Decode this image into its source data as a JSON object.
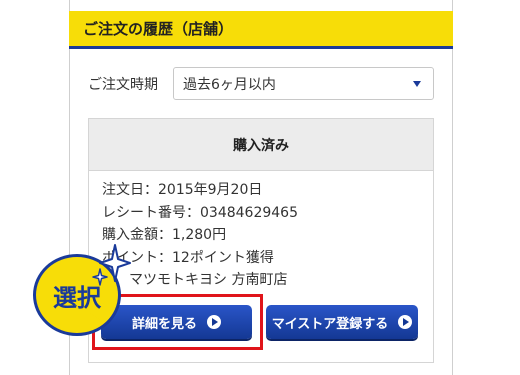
{
  "header": {
    "title": "ご注文の履歴（店舗）"
  },
  "filter": {
    "label": "ご注文時期",
    "selected": "過去6ヶ月以内"
  },
  "order": {
    "status": "購入済み",
    "date": "注文日：2015年9月20日",
    "receipt": "レシート番号：03484629465",
    "amount": "購入金額：1,280円",
    "points_prefix": "ポ",
    "points": "イント：12ポイント獲得",
    "store": "マツモトキヨシ 方南町店"
  },
  "buttons": {
    "detail": "詳細を見る",
    "mystore": "マイストア登録する"
  },
  "callout": {
    "label": "選択"
  },
  "colors": {
    "accent_yellow": "#f7dd08",
    "brand_blue": "#1a3a9a",
    "highlight_red": "#e0141a"
  },
  "icons": {
    "select": "chevron-down-icon",
    "button": "play-circle-icon",
    "callout": "sparkle-icon"
  }
}
